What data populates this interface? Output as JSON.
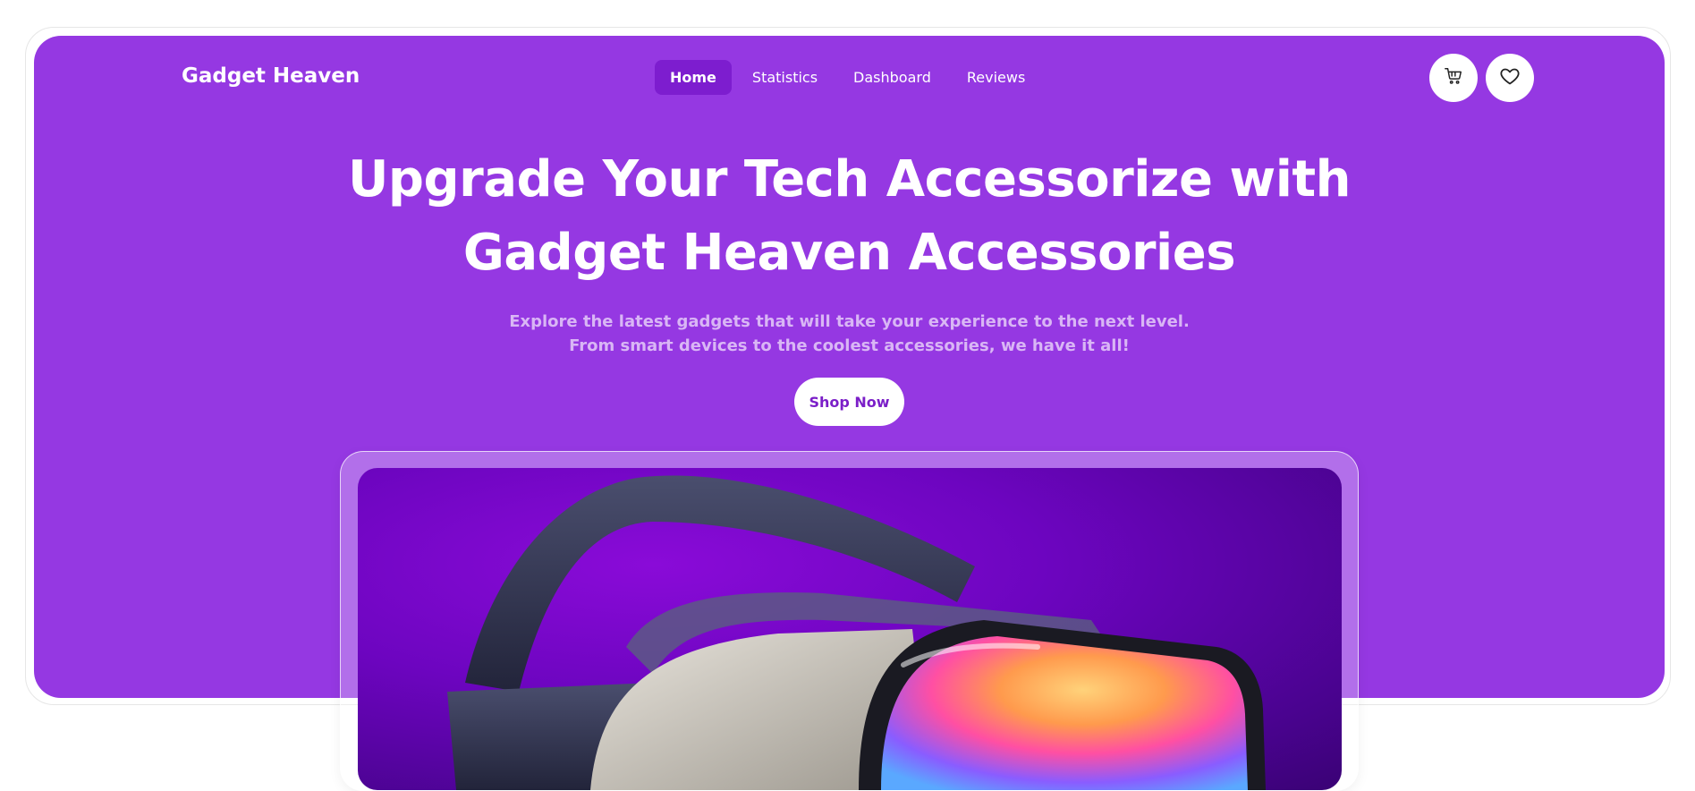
{
  "brand": {
    "name": "Gadget Heaven"
  },
  "nav": {
    "items": [
      {
        "label": "Home",
        "active": true
      },
      {
        "label": "Statistics",
        "active": false
      },
      {
        "label": "Dashboard",
        "active": false
      },
      {
        "label": "Reviews",
        "active": false
      }
    ],
    "icons": [
      "cart-icon",
      "heart-icon"
    ]
  },
  "hero": {
    "headline_line1": "Upgrade Your Tech Accessorize with",
    "headline_line2": "Gadget Heaven Accessories",
    "subtitle_line1": "Explore the latest gadgets that will take your experience to the next level.",
    "subtitle_line2": "From smart devices to the coolest accessories, we have it all!",
    "cta_label": "Shop Now"
  },
  "colors": {
    "primary": "#9538e2",
    "nav_active": "#7d1dcf",
    "subtitle": "#d9b6f5",
    "cta_text": "#7b1fc8"
  }
}
